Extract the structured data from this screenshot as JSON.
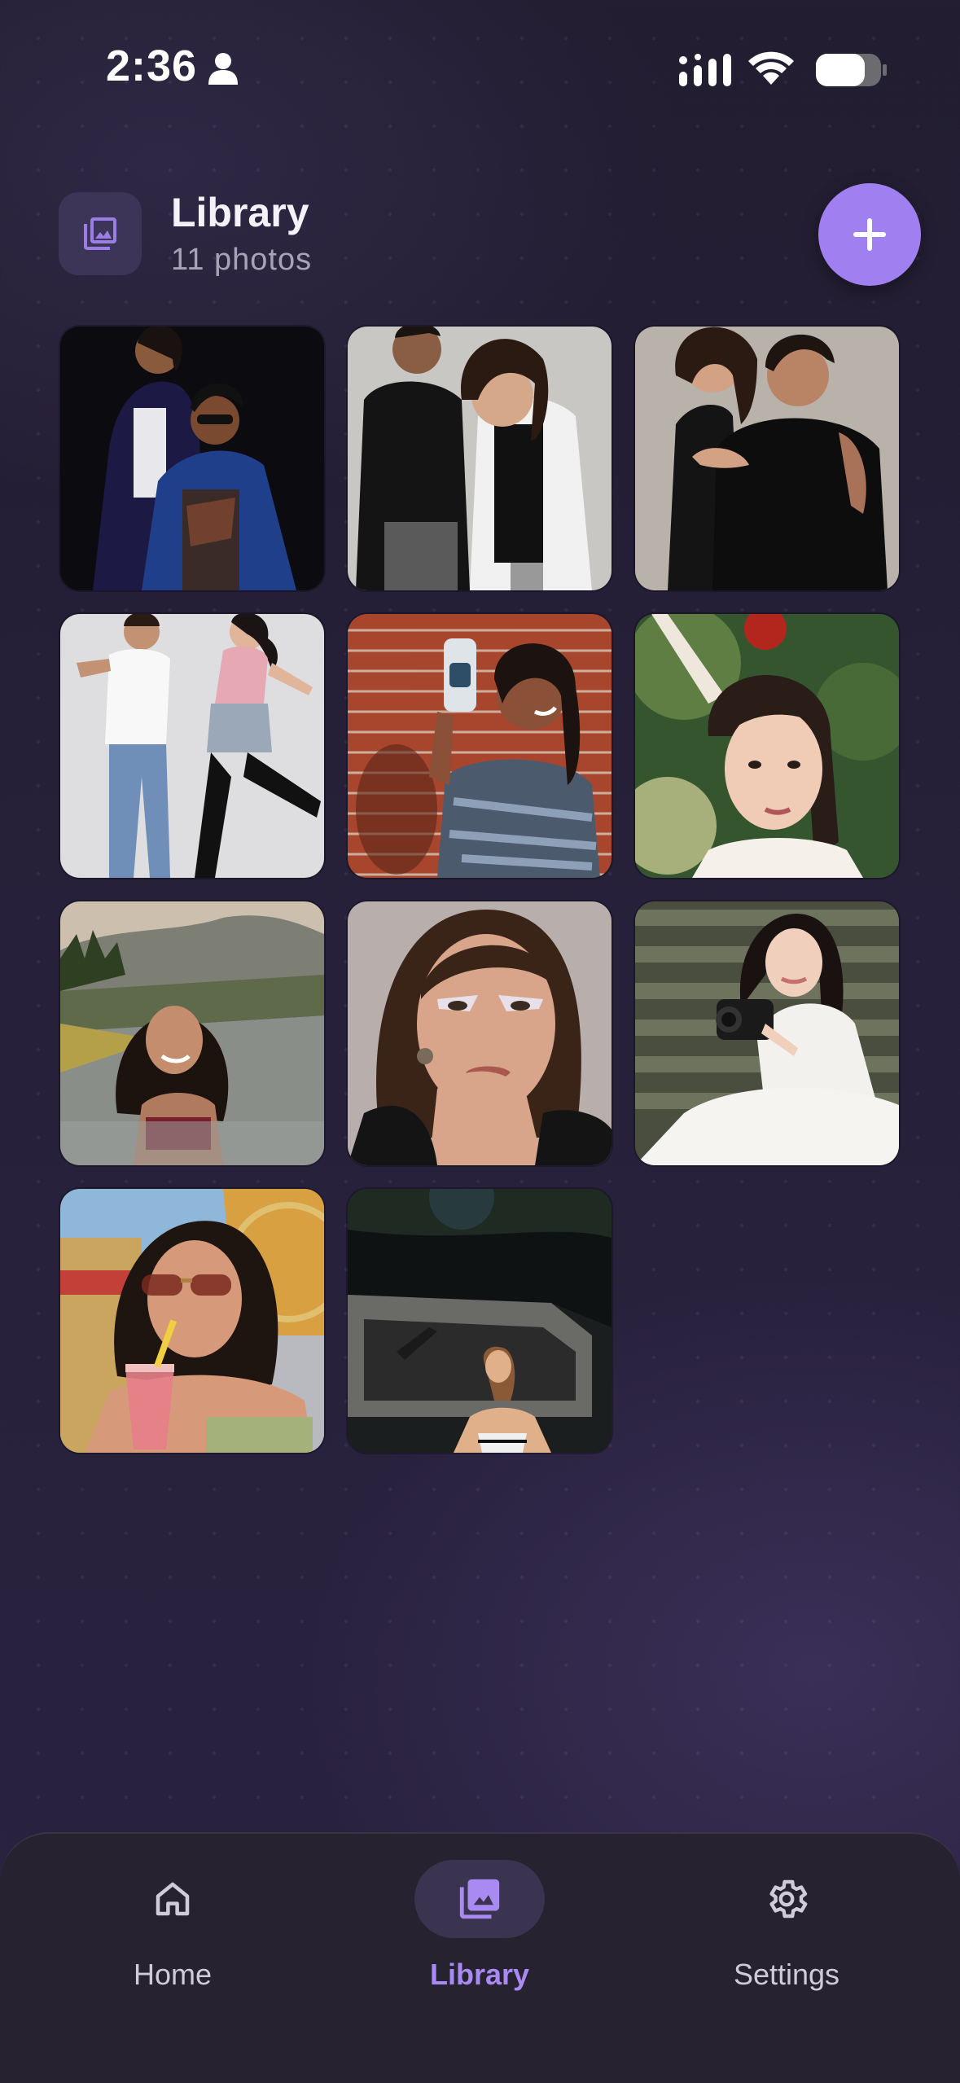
{
  "status_bar": {
    "time": "2:36"
  },
  "header": {
    "title": "Library",
    "subtitle": "11 photos",
    "icon": "photo-library-icon",
    "add_icon": "plus-icon"
  },
  "photos": [
    {
      "name": "photo-couple-dark-studio"
    },
    {
      "name": "photo-couple-black-white"
    },
    {
      "name": "photo-couple-embrace"
    },
    {
      "name": "photo-couple-dancing"
    },
    {
      "name": "photo-woman-selfie-brick"
    },
    {
      "name": "photo-woman-apple-head"
    },
    {
      "name": "photo-woman-infinity-pool"
    },
    {
      "name": "photo-woman-glam-makeup"
    },
    {
      "name": "photo-woman-camera-stairs"
    },
    {
      "name": "photo-woman-drink-fair"
    },
    {
      "name": "photo-woman-night-street"
    }
  ],
  "nav": {
    "items": [
      {
        "label": "Home",
        "icon": "home-icon",
        "active": false
      },
      {
        "label": "Library",
        "icon": "photo-library-icon",
        "active": true
      },
      {
        "label": "Settings",
        "icon": "gear-icon",
        "active": false
      }
    ]
  },
  "colors": {
    "accent": "#a07ff0",
    "active_label": "#a98af2",
    "background": "#241e33",
    "nav_bg": "#27222f"
  }
}
